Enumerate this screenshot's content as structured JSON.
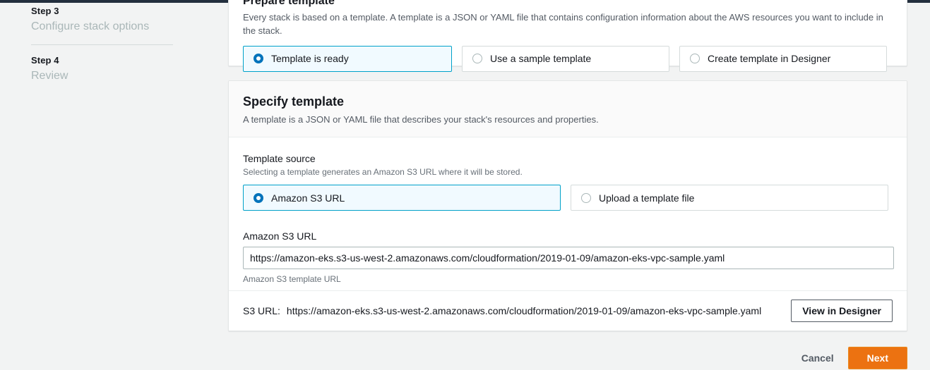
{
  "theme": {
    "page_bg": "#f2f3f3",
    "accent_selected": "#00a1c9",
    "accent_selected_bg": "#f1faff",
    "radio_checked": "#0073bb",
    "primary_button": "#ec7211",
    "nav_bar": "#232f3e"
  },
  "sidebar": {
    "steps": [
      {
        "number": "Step 3",
        "label": "Configure stack options"
      },
      {
        "number": "Step 4",
        "label": "Review"
      }
    ]
  },
  "prepare_template": {
    "title": "Prepare template",
    "description": "Every stack is based on a template. A template is a JSON or YAML file that contains configuration information about the AWS resources you want to include in the stack.",
    "options": [
      {
        "label": "Template is ready",
        "selected": true
      },
      {
        "label": "Use a sample template",
        "selected": false
      },
      {
        "label": "Create template in Designer",
        "selected": false
      }
    ]
  },
  "specify_template": {
    "title": "Specify template",
    "subtitle": "A template is a JSON or YAML file that describes your stack's resources and properties.",
    "template_source": {
      "label": "Template source",
      "hint": "Selecting a template generates an Amazon S3 URL where it will be stored.",
      "options": [
        {
          "label": "Amazon S3 URL",
          "selected": true
        },
        {
          "label": "Upload a template file",
          "selected": false
        }
      ]
    },
    "s3_url_field": {
      "label": "Amazon S3 URL",
      "value": "https://amazon-eks.s3-us-west-2.amazonaws.com/cloudformation/2019-01-09/amazon-eks-vpc-sample.yaml",
      "placeholder": "https://",
      "hint": "Amazon S3 template URL"
    },
    "footer": {
      "s3_url_label": "S3 URL:",
      "s3_url_value": "https://amazon-eks.s3-us-west-2.amazonaws.com/cloudformation/2019-01-09/amazon-eks-vpc-sample.yaml",
      "designer_button": "View in Designer"
    }
  },
  "actions": {
    "cancel": "Cancel",
    "next": "Next"
  }
}
